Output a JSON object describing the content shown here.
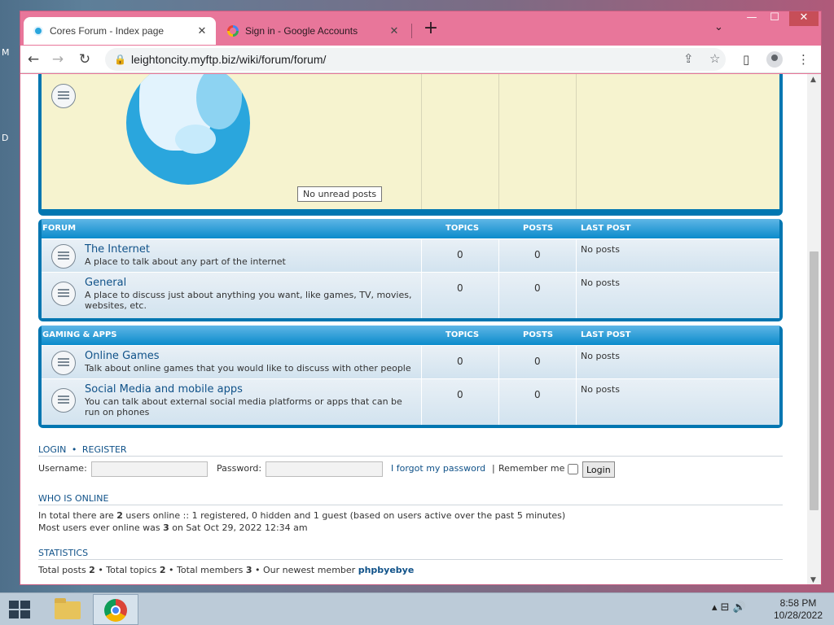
{
  "desktop": {
    "left_text_1": "M",
    "left_text_2": "D"
  },
  "browser": {
    "tabs": [
      {
        "title": "Cores Forum - Index page",
        "close": "✕",
        "icon": "forum-favicon-icon"
      },
      {
        "title": "Sign in - Google Accounts",
        "close": "✕",
        "icon": "google-g-icon"
      }
    ],
    "new_tab": "+",
    "tab_search": "⌄",
    "window": {
      "minimize": "—",
      "maximize": "☐",
      "close": "✕"
    },
    "url": "leightoncity.myftp.biz/wiki/forum/forum/",
    "nav": {
      "back": "←",
      "forward": "→",
      "reload": "↻"
    },
    "icons": {
      "share": "⇪",
      "star": "☆",
      "sidepanel": "▯",
      "menu": "⋮",
      "lock": "🔒"
    }
  },
  "forum": {
    "tooltip": "No unread posts",
    "categories": [
      {
        "name": "FORUM",
        "topics_label": "TOPICS",
        "posts_label": "POSTS",
        "last_label": "LAST POST",
        "rows": [
          {
            "title": "The Internet",
            "desc": "A place to talk about any part of the internet",
            "topics": "0",
            "posts": "0",
            "last": "No posts"
          },
          {
            "title": "General",
            "desc": "A place to discuss just about anything you want, like games, TV, movies, websites, etc.",
            "topics": "0",
            "posts": "0",
            "last": "No posts"
          }
        ]
      },
      {
        "name": "GAMING & APPS",
        "topics_label": "TOPICS",
        "posts_label": "POSTS",
        "last_label": "LAST POST",
        "rows": [
          {
            "title": "Online Games",
            "desc": "Talk about online games that you would like to discuss with other people",
            "topics": "0",
            "posts": "0",
            "last": "No posts"
          },
          {
            "title": "Social Media and mobile apps",
            "desc": "You can talk about external social media platforms or apps that can be run on phones",
            "topics": "0",
            "posts": "0",
            "last": "No posts"
          }
        ]
      }
    ],
    "login": {
      "login_link": "LOGIN",
      "sep": "•",
      "register_link": "REGISTER",
      "username_label": "Username:",
      "password_label": "Password:",
      "forgot": "I forgot my password",
      "pipe": "|",
      "remember": "Remember me",
      "button": "Login"
    },
    "online": {
      "title": "WHO IS ONLINE",
      "line1_a": "In total there are ",
      "line1_count": "2",
      "line1_b": " users online :: 1 registered, 0 hidden and 1 guest (based on users active over the past 5 minutes)",
      "line2_a": "Most users ever online was ",
      "line2_count": "3",
      "line2_b": " on Sat Oct 29, 2022 12:34 am"
    },
    "stats": {
      "title": "STATISTICS",
      "a": "Total posts ",
      "posts": "2",
      "b": " • Total topics ",
      "topics": "2",
      "c": " • Total members ",
      "members": "3",
      "d": " • Our newest member ",
      "newest": "phpbyebye"
    }
  },
  "taskbar": {
    "tray": "▴  ⊟  🔊",
    "time": "8:58 PM",
    "date": "10/28/2022"
  },
  "colors": {
    "forum_header": "#0076b1",
    "browser_frame": "#e8769a",
    "link": "#105289"
  }
}
